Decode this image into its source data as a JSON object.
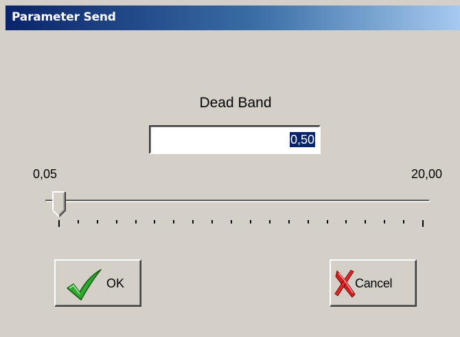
{
  "window": {
    "title": "Parameter Send"
  },
  "field": {
    "label": "Dead Band",
    "value": "0,50"
  },
  "slider": {
    "min_label": "0,05",
    "max_label": "20,00",
    "level_fraction": 0.0,
    "tick_count": 20
  },
  "buttons": {
    "ok_label": "OK",
    "ok_icon": "checkmark-icon",
    "cancel_label": "Cancel",
    "cancel_icon": "red-x-icon"
  },
  "colors": {
    "titlebar_start": "#0a246a",
    "titlebar_end": "#a6caf0",
    "selection": "#0a246a",
    "check_green": "#2fa82f",
    "cancel_red": "#d42020"
  }
}
